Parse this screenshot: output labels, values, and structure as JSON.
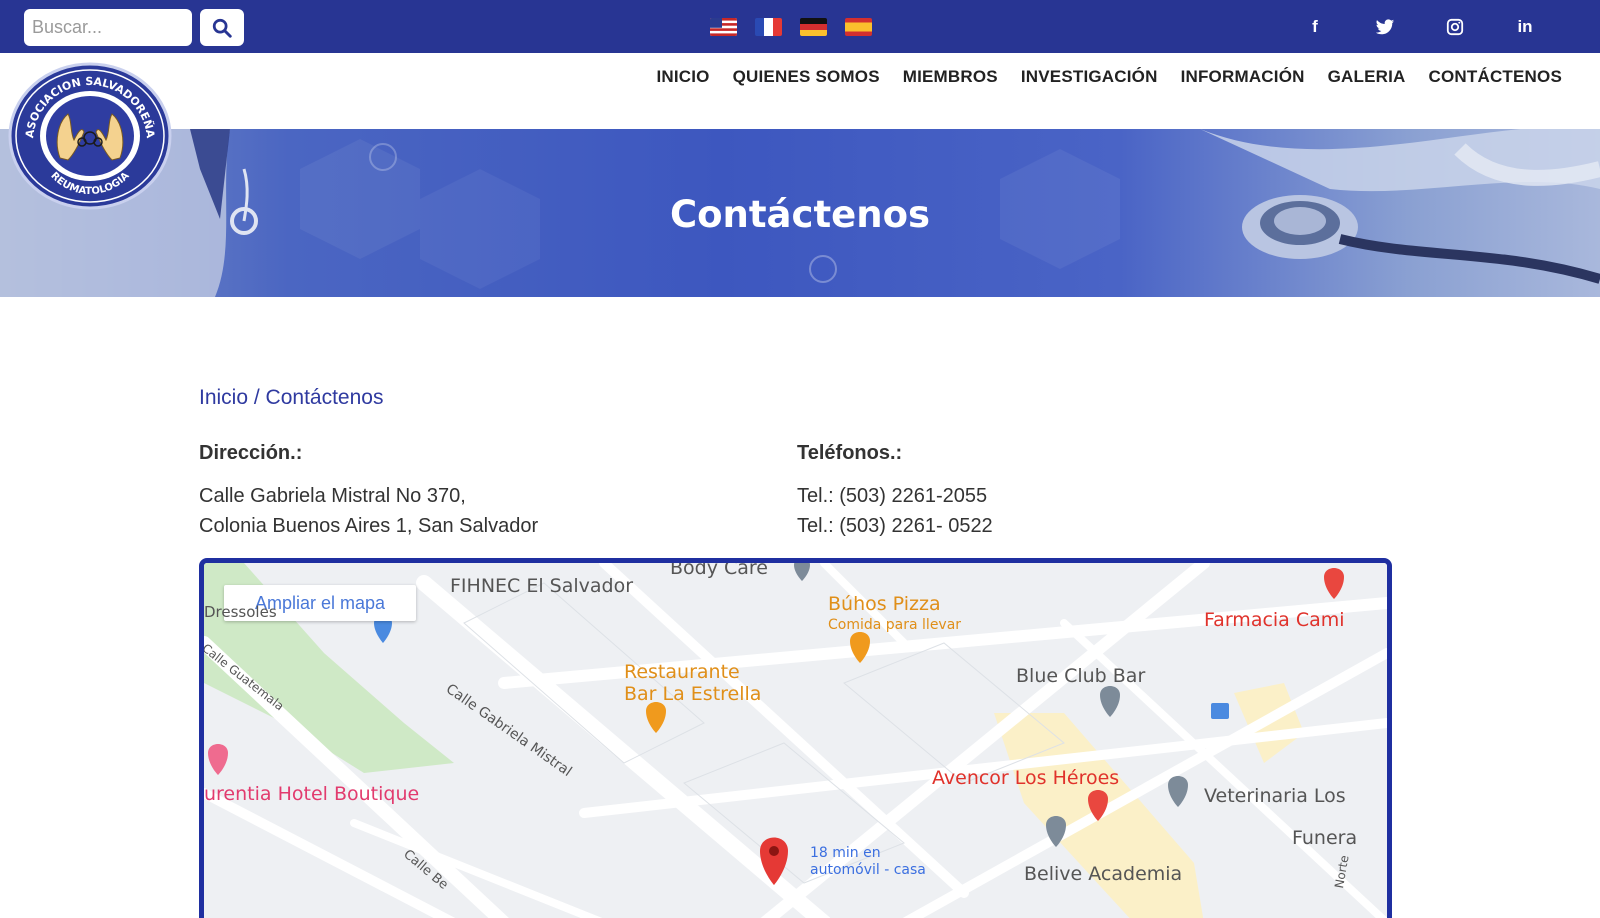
{
  "topbar": {
    "search": {
      "placeholder": "Buscar..."
    },
    "flags": [
      "us-flag-icon",
      "fr-flag-icon",
      "de-flag-icon",
      "es-flag-icon"
    ],
    "social": [
      {
        "icon": "facebook-icon",
        "label": "f"
      },
      {
        "icon": "twitter-icon",
        "label": ""
      },
      {
        "icon": "instagram-icon",
        "label": ""
      },
      {
        "icon": "linkedin-icon",
        "label": "in"
      }
    ],
    "colors": {
      "bar": "#283593"
    }
  },
  "nav": {
    "items": [
      "INICIO",
      "QUIENES SOMOS",
      "MIEMBROS",
      "INVESTIGACIÓN",
      "INFORMACIÓN",
      "GALERIA",
      "CONTÁCTENOS"
    ]
  },
  "logo": {
    "text_top": "ASOCIACION SALVADOREÑA",
    "text_bottom": "REUMATOLOGIA"
  },
  "hero": {
    "title": "Contáctenos"
  },
  "breadcrumb": {
    "home": "Inicio",
    "separator": " / ",
    "current": "Contáctenos"
  },
  "address": {
    "heading": "Dirección.:",
    "line1": "Calle Gabriela Mistral No 370,",
    "line2": "Colonia Buenos Aires 1, San Salvador"
  },
  "phones": {
    "heading": "Teléfonos.:",
    "line1": "Tel.: (503) 2261-2055",
    "line2": "Tel.: (503) 2261- 0522"
  },
  "map": {
    "enlarge_label": "Ampliar el mapa",
    "labels": {
      "fihnec": "FIHNEC El Salvador",
      "body_care": "Body Care",
      "buhos": "Búhos Pizza",
      "buhos_sub": "Comida para llevar",
      "farmacia": "Farmacia Cami",
      "calle_gabriela": "Calle Gabriela Mistral",
      "calle_guatemala": "Calle Guatemala",
      "restaurante1": "Restaurante",
      "restaurante2": "Bar La Estrella",
      "blue_club": "Blue Club Bar",
      "hotel": "urentia Hotel Boutique",
      "avencor": "Avencor Los Héroes",
      "veterinaria": "Veterinaria Los",
      "funera": "Funera",
      "belive": "Belive Academia",
      "route1": "18 min en",
      "route2": "automóvil - casa",
      "calle_bottom": "Calle Be",
      "norte": "Norte",
      "top_left": "Dressoles"
    }
  }
}
